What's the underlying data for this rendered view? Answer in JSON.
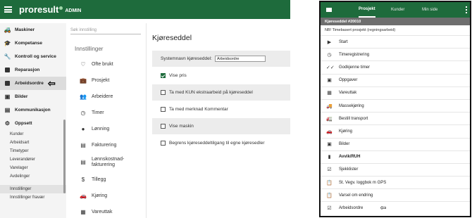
{
  "admin": {
    "brand": "proresult",
    "brand_suffix": "ADMIN",
    "sidebar": {
      "items": [
        {
          "label": "Maskiner",
          "icon": "truck-icon"
        },
        {
          "label": "Kompetanse",
          "icon": "graduation-icon"
        },
        {
          "label": "Kontroll og service",
          "icon": "wrench-icon"
        },
        {
          "label": "Reparasjon",
          "icon": "checkbox-icon"
        },
        {
          "label": "Arbeidsordre",
          "icon": "checkbox-icon"
        },
        {
          "label": "Bilder",
          "icon": "image-icon"
        },
        {
          "label": "Kommunikasjon",
          "icon": "chat-icon"
        },
        {
          "label": "Oppsett",
          "icon": "gear-icon"
        }
      ],
      "sub_items": [
        "Kunder",
        "Arbeidsart",
        "Timetyper",
        "Leverandører",
        "Varelager",
        "Avdelinger"
      ],
      "bottom_items": [
        "Innstillinger",
        "Innstillinger fravær"
      ]
    },
    "settings": {
      "search_placeholder": "Søk innstilling",
      "title": "Innstillinger",
      "items": [
        {
          "label": "Ofte brukt",
          "icon": "heart-icon"
        },
        {
          "label": "Prosjekt",
          "icon": "briefcase-icon"
        },
        {
          "label": "Arbeidere",
          "icon": "people-icon"
        },
        {
          "label": "Timer",
          "icon": "clock-icon"
        },
        {
          "label": "Lønning",
          "icon": "money-icon"
        },
        {
          "label": "Fakturering",
          "icon": "document-icon"
        },
        {
          "label": "Lønnskostnad-\nfakturering",
          "icon": "document-icon"
        },
        {
          "label": "Tillegg",
          "icon": "dollar-icon"
        },
        {
          "label": "Kjøring",
          "icon": "car-icon"
        },
        {
          "label": "Vareuttak",
          "icon": "grid-icon"
        }
      ]
    },
    "main": {
      "title": "Kjøreseddel",
      "system_name_label": "Systemnavn kjøreseddel:",
      "system_name_value": "Arbeidsordre",
      "options": [
        {
          "label": "Vise pris",
          "checked": true
        },
        {
          "label": "Ta med KUN ekstraarbeid på kjøreseddel",
          "checked": false
        },
        {
          "label": "Ta med merknad Kommentar",
          "checked": false
        },
        {
          "label": "Vise maskin",
          "checked": false
        },
        {
          "label": "Begrens kjøreseddeltilgang til egne kjøresedler",
          "checked": false
        }
      ]
    }
  },
  "mobile": {
    "tabs": [
      "Prosjekt",
      "Kunder",
      "Min side"
    ],
    "header": "Kjøreseddel #20010",
    "note": "NB! Timebasert prosjekt (regningsarbeid)",
    "items": [
      {
        "label": "Start",
        "icon": "play-icon"
      },
      {
        "label": "Timeregistrering",
        "icon": "clock-icon"
      },
      {
        "label": "Godkjenne timer",
        "icon": "double-check-icon"
      },
      {
        "label": "Oppgaver",
        "icon": "task-icon"
      },
      {
        "label": "Vareuttak",
        "icon": "grid-icon"
      },
      {
        "label": "Massekjøring",
        "icon": "truck-icon"
      },
      {
        "label": "Bestill transport",
        "icon": "bus-icon"
      },
      {
        "label": "Kjøring",
        "icon": "car-icon"
      },
      {
        "label": "Bilder",
        "icon": "image-icon"
      },
      {
        "label": "Avvik/RUH",
        "icon": "warning-doc-icon"
      },
      {
        "label": "Sjekklister",
        "icon": "checkbox-icon"
      },
      {
        "label": "St. Vegv. loggbok m GPS",
        "icon": "clipboard-icon"
      },
      {
        "label": "Varsel om endring",
        "icon": "clipboard-icon"
      },
      {
        "label": "Arbeidsordre",
        "icon": "checkbox-icon"
      }
    ]
  },
  "colors": {
    "brand_green": "#1e6b3c",
    "header_gray": "#6e6e6e"
  }
}
